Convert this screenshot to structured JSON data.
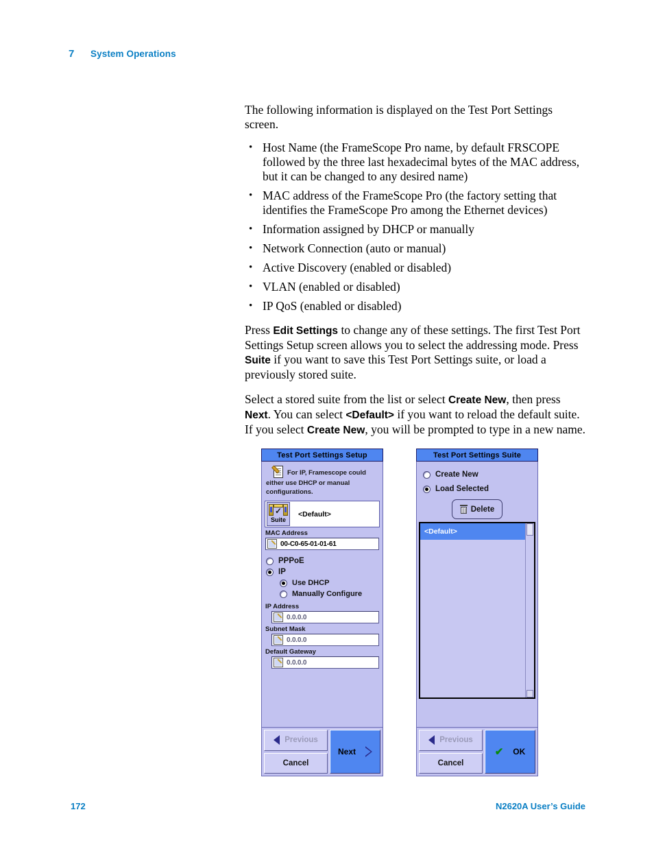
{
  "header": {
    "chapter_number": "7",
    "chapter_title": "System Operations"
  },
  "content": {
    "intro": "The following information is displayed on the Test Port Settings screen.",
    "bullets": [
      "Host Name (the FrameScope Pro name, by default FRSCOPE followed by the three last hexadecimal bytes of the MAC address, but it can be changed to any desired name)",
      "MAC address of the FrameScope Pro (the factory setting that identifies the FrameScope Pro among the Ethernet devices)",
      "Information assigned by DHCP or manually",
      "Network Connection (auto or manual)",
      "Active Discovery (enabled or disabled)",
      "VLAN (enabled or disabled)",
      "IP QoS (enabled or disabled)"
    ],
    "para2": {
      "p1": "Press ",
      "b1": "Edit Settings",
      "p2": " to change any of these settings. The first Test Port Settings Setup screen allows you to select the addressing mode. Press ",
      "b2": "Suite",
      "p3": " if you want to save this Test Port Settings suite, or load a previously stored suite."
    },
    "para3": {
      "p1": "Select a stored suite from the list or select ",
      "b1": "Create New",
      "p2": ", then press ",
      "b2": "Next",
      "p3": ". You can select ",
      "b3": "<Default>",
      "p4": " if you want to reload the default suite. If you select ",
      "b4": "Create New",
      "p5": ", you will be prompted to type in a new name."
    }
  },
  "screenshot_left": {
    "title": "Test Port Settings Setup",
    "hint_icon": "document-pencil-icon",
    "hint_text": "For IP, Framescope could either use DHCP or manual configurations.",
    "suite_button_label": "Suite",
    "suite_icon": "suite-device-check-icon",
    "suite_value": "<Default>",
    "mac_label": "MAC Address",
    "mac_value": "00-C0-65-01-01-61",
    "radios": [
      {
        "label": "PPPoE",
        "selected": false,
        "sub": false
      },
      {
        "label": "IP",
        "selected": true,
        "sub": false
      },
      {
        "label": "Use DHCP",
        "selected": true,
        "sub": true
      },
      {
        "label": "Manually Configure",
        "selected": false,
        "sub": true
      }
    ],
    "fields": [
      {
        "label": "IP Address",
        "value": "0.0.0.0"
      },
      {
        "label": "Subnet Mask",
        "value": "0.0.0.0"
      },
      {
        "label": "Default Gateway",
        "value": "0.0.0.0"
      }
    ],
    "buttons": {
      "previous": "Previous",
      "cancel": "Cancel",
      "primary": "Next"
    }
  },
  "screenshot_right": {
    "title": "Test Port Settings Suite",
    "radios": [
      {
        "label": "Create New",
        "selected": false
      },
      {
        "label": "Load Selected",
        "selected": true
      }
    ],
    "delete_label": "Delete",
    "delete_icon": "trash-icon",
    "list_items": [
      "<Default>"
    ],
    "buttons": {
      "previous": "Previous",
      "cancel": "Cancel",
      "primary": "OK"
    }
  },
  "footer": {
    "page_number": "172",
    "guide_title": "N2620A User’s Guide"
  },
  "colors": {
    "accent_blue": "#0a7fc4",
    "titlebar_blue": "#4f86f0",
    "panel_lavender": "#c2c2f0"
  }
}
